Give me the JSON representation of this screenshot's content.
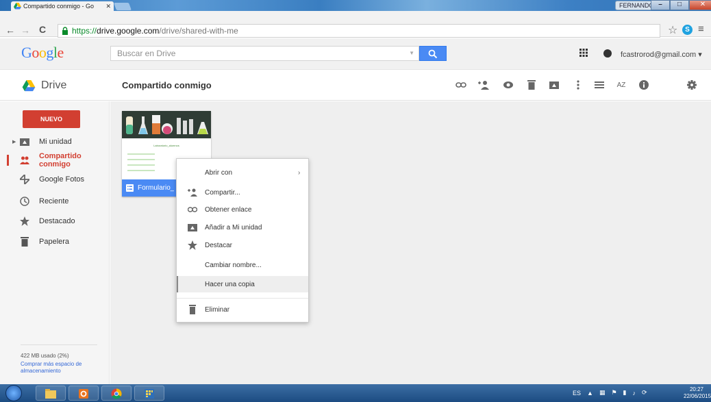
{
  "browser": {
    "tab_title": "Compartido conmigo - Go",
    "url_scheme": "https://",
    "url_host": "drive.google.com",
    "url_path": "/drive/shared-with-me",
    "os_user": "FERNANDO"
  },
  "header": {
    "logo": "Google",
    "search_placeholder": "Buscar en Drive",
    "account": "fcastrorod@gmail.com"
  },
  "actionbar": {
    "app_name": "Drive",
    "breadcrumb": "Compartido conmigo",
    "sort_label": "AZ"
  },
  "sidebar": {
    "new_button": "NUEVO",
    "items": [
      {
        "label": "Mi unidad",
        "icon": "my-drive-icon"
      },
      {
        "label": "Compartido conmigo",
        "icon": "shared-icon",
        "active": true
      },
      {
        "label": "Google Fotos",
        "icon": "photos-icon"
      },
      {
        "label": "Reciente",
        "icon": "clock-icon"
      },
      {
        "label": "Destacado",
        "icon": "star-icon"
      },
      {
        "label": "Papelera",
        "icon": "trash-icon"
      }
    ],
    "storage_used": "422 MB usado (2%)",
    "storage_link": "Comprar más espacio de almacenamiento"
  },
  "file": {
    "name": "Formulario_",
    "thumb_title": "Laboratorio_alumnos"
  },
  "context_menu": {
    "items": [
      {
        "label": "Abrir con",
        "icon": "",
        "submenu_arrow": "›"
      },
      {
        "label": "Compartir...",
        "icon": "add-person-icon"
      },
      {
        "label": "Obtener enlace",
        "icon": "link-icon"
      },
      {
        "label": "Añadir a Mi unidad",
        "icon": "add-to-drive-icon"
      },
      {
        "label": "Destacar",
        "icon": "star-icon"
      },
      {
        "label": "Cambiar nombre...",
        "icon": ""
      },
      {
        "label": "Hacer una copia",
        "icon": "",
        "hover": true
      },
      {
        "label": "Eliminar",
        "icon": "trash-icon"
      }
    ]
  },
  "taskbar": {
    "language": "ES",
    "time": "20:27",
    "date": "22/06/2015"
  },
  "colors": {
    "accent_red": "#d23f31",
    "accent_blue": "#4a8af4"
  }
}
